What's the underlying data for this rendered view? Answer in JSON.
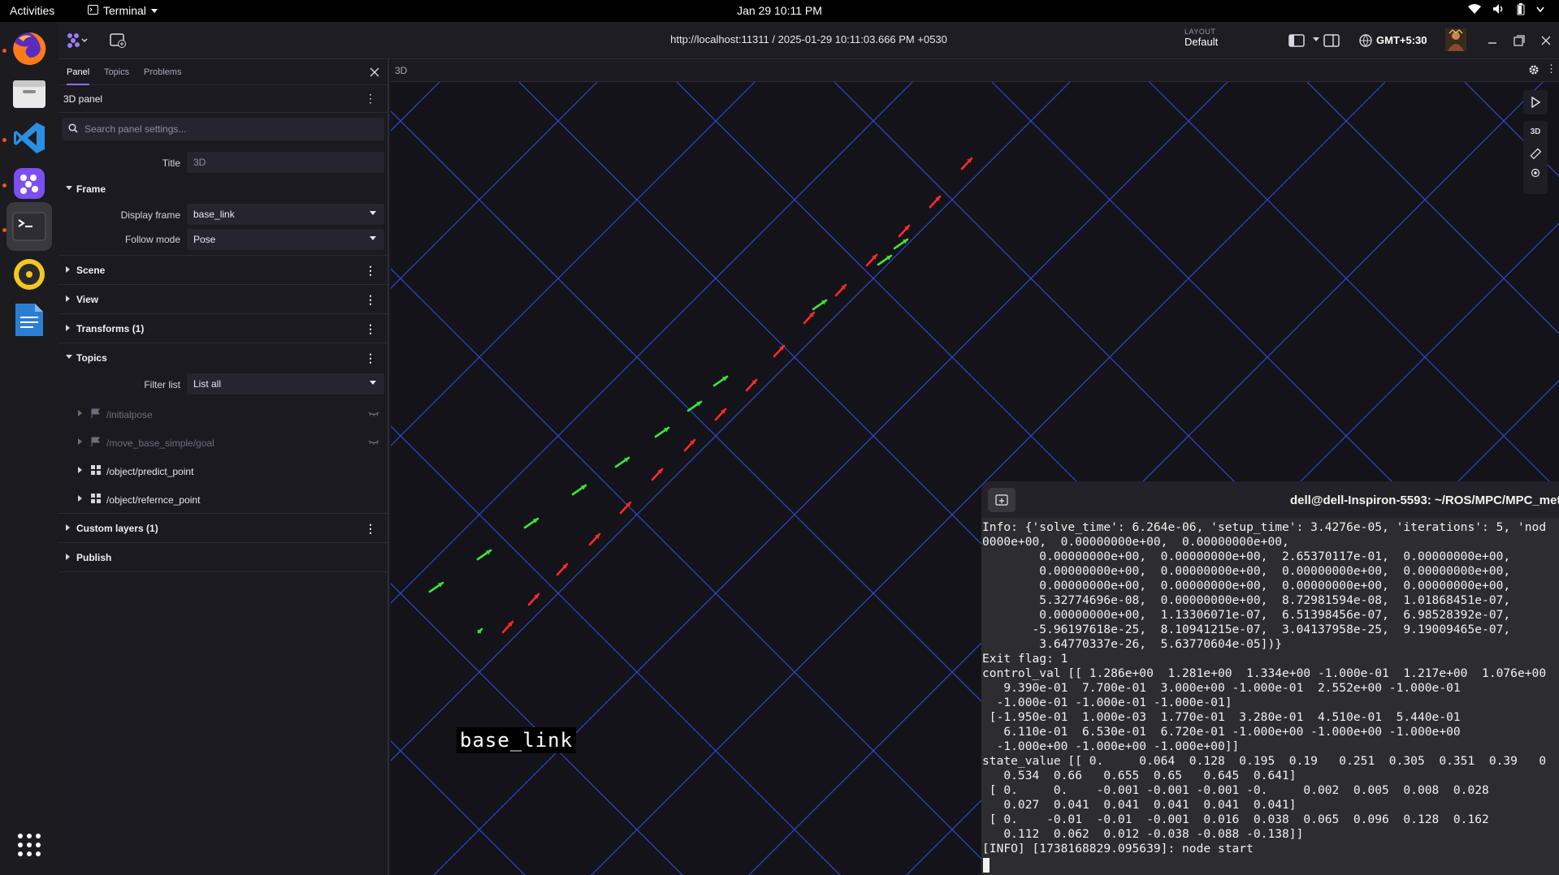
{
  "topbar": {
    "activities": "Activities",
    "app_menu": "Terminal",
    "clock": "Jan 29  10:11 PM"
  },
  "dock": {
    "items": [
      {
        "name": "Firefox",
        "icon": "firefox-icon"
      },
      {
        "name": "Files",
        "icon": "files-icon"
      },
      {
        "name": "Visual Studio Code",
        "icon": "vscode-icon"
      },
      {
        "name": "Foxglove",
        "icon": "foxglove-icon"
      },
      {
        "name": "Terminal",
        "icon": "terminal-icon"
      },
      {
        "name": "Rhythmbox",
        "icon": "rhythmbox-icon"
      },
      {
        "name": "LibreOffice Writer",
        "icon": "writer-icon"
      }
    ],
    "apps_grid": "show-apps-icon"
  },
  "header": {
    "url": "http://localhost:11311 / 2025-01-29 10:11:03.666 PM +0530",
    "layout_caption": "LAYOUT",
    "layout_value": "Default",
    "timezone": "GMT+5:30"
  },
  "sidebar": {
    "tabs": [
      "Panel",
      "Topics",
      "Problems"
    ],
    "panel_title": "3D panel",
    "search_placeholder": "Search panel settings...",
    "title_label": "Title",
    "title_value": "3D",
    "frame_section": "Frame",
    "display_frame_label": "Display frame",
    "display_frame_value": "base_link",
    "follow_mode_label": "Follow mode",
    "follow_mode_value": "Pose",
    "scene": "Scene",
    "view": "View",
    "transforms": "Transforms (1)",
    "topics_section": "Topics",
    "filter_label": "Filter list",
    "filter_value": "List all",
    "topics": [
      "/initialpose",
      "/move_base_simple/goal",
      "/object/predict_point",
      "/object/refernce_point"
    ],
    "custom_layers": "Custom layers (1)",
    "publish": "Publish"
  },
  "viewport": {
    "title": "3D",
    "frame_label": "base_link",
    "view_mode": "3D"
  },
  "terminal": {
    "title": "dell@dell-Inspiron-5593: ~/ROS/MPC/MPC_met",
    "lines": [
      "Info: {'solve_time': 6.264e-06, 'setup_time': 3.4276e-05, 'iterations': 5, 'nod",
      "0000e+00,  0.00000000e+00,  0.00000000e+00,",
      "        0.00000000e+00,  0.00000000e+00,  2.65370117e-01,  0.00000000e+00,",
      "        0.00000000e+00,  0.00000000e+00,  0.00000000e+00,  0.00000000e+00,",
      "        0.00000000e+00,  0.00000000e+00,  0.00000000e+00,  0.00000000e+00,",
      "        5.32774696e-08,  0.00000000e+00,  8.72981594e-08,  1.01868451e-07,",
      "        0.00000000e+00,  1.13306071e-07,  6.51398456e-07,  6.98528392e-07,",
      "       -5.96197618e-25,  8.10941215e-07,  3.04137958e-25,  9.19009465e-07,",
      "        3.64770337e-26,  5.63770604e-05])}",
      "Exit flag: 1",
      "control_val [[ 1.286e+00  1.281e+00  1.334e+00 -1.000e-01  1.217e+00  1.076e+00",
      "   9.390e-01  7.700e-01  3.000e+00 -1.000e-01  2.552e+00 -1.000e-01",
      "  -1.000e-01 -1.000e-01 -1.000e-01]",
      " [-1.950e-01  1.000e-03  1.770e-01  3.280e-01  4.510e-01  5.440e-01",
      "   6.110e-01  6.530e-01  6.720e-01 -1.000e+00 -1.000e+00 -1.000e+00",
      "  -1.000e+00 -1.000e+00 -1.000e+00]]",
      "state_value [[ 0.     0.064  0.128  0.195  0.19   0.251  0.305  0.351  0.39   0",
      "   0.534  0.66   0.655  0.65   0.645  0.641]",
      " [ 0.     0.    -0.001 -0.001 -0.001 -0.     0.002  0.005  0.008  0.028",
      "   0.027  0.041  0.041  0.041  0.041  0.041]",
      " [ 0.    -0.01  -0.01  -0.001  0.016  0.038  0.065  0.096  0.128  0.162",
      "   0.112  0.062  0.012 -0.038 -0.088 -0.138]]",
      "[INFO] [1738168829.095639]: node start"
    ]
  }
}
